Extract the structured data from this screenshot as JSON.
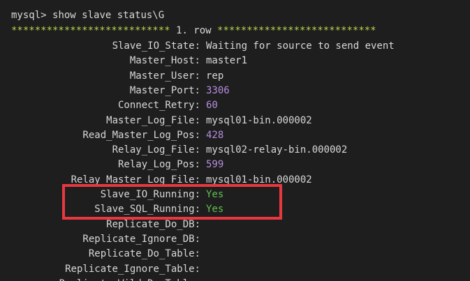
{
  "terminal": {
    "prompt": "mysql>",
    "command": "show slave status\\G",
    "banner_stars_left": "***************************",
    "banner_text": "1. row",
    "banner_stars_right": "***************************"
  },
  "rows": [
    {
      "field": "Slave_IO_State:",
      "value": "Waiting for source to send event",
      "kind": "text"
    },
    {
      "field": "Master_Host:",
      "value": "master1",
      "kind": "text"
    },
    {
      "field": "Master_User:",
      "value": "rep",
      "kind": "text"
    },
    {
      "field": "Master_Port:",
      "value": "3306",
      "kind": "num"
    },
    {
      "field": "Connect_Retry:",
      "value": "60",
      "kind": "num"
    },
    {
      "field": "Master_Log_File:",
      "value": "mysql01-bin.000002",
      "kind": "text"
    },
    {
      "field": "Read_Master_Log_Pos:",
      "value": "428",
      "kind": "num"
    },
    {
      "field": "Relay_Log_File:",
      "value": "mysql02-relay-bin.000002",
      "kind": "text"
    },
    {
      "field": "Relay_Log_Pos:",
      "value": "599",
      "kind": "num"
    },
    {
      "field": "Relay_Master_Log_File:",
      "value": "mysql01-bin.000002",
      "kind": "text"
    },
    {
      "field": "Slave_IO_Running:",
      "value": "Yes",
      "kind": "yes"
    },
    {
      "field": "Slave_SQL_Running:",
      "value": "Yes",
      "kind": "yes"
    },
    {
      "field": "Replicate_Do_DB:",
      "value": "",
      "kind": "text"
    },
    {
      "field": "Replicate_Ignore_DB:",
      "value": "",
      "kind": "text"
    },
    {
      "field": "Replicate_Do_Table:",
      "value": "",
      "kind": "text"
    },
    {
      "field": "Replicate_Ignore_Table:",
      "value": "",
      "kind": "text"
    },
    {
      "field": "Replicate_Wild_Do_Table:",
      "value": "",
      "kind": "text"
    }
  ],
  "colors": {
    "background": "#1e1e1e",
    "text": "#d8d8d8",
    "stars": "#b8d64a",
    "number": "#b48ee0",
    "yes": "#5fc04f",
    "highlight": "#e8383f"
  }
}
